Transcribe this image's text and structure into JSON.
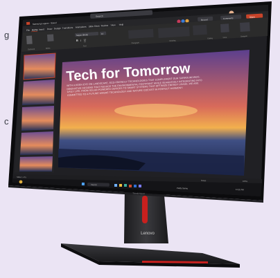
{
  "background_fragments": [
    "g",
    "c"
  ],
  "app": {
    "search_placeholder": "Search",
    "file_name": "Samsung Lagoon - Saved",
    "menu": [
      "File",
      "Home",
      "Insert",
      "Draw",
      "Design",
      "Transitions",
      "Animations",
      "Slide Show",
      "Review",
      "View",
      "Help"
    ],
    "active_menu": "Home",
    "record_label": "Record",
    "comments_label": "Comments",
    "share_label": "Share",
    "font_name": "Segoe (Body)",
    "font_size": "14",
    "ribbon_groups": [
      "Clipboard",
      "Slides",
      "Font",
      "Paragraph",
      "Drawing",
      "Editing",
      "Voice",
      "Designer"
    ]
  },
  "slide": {
    "title": "Tech for Tomorrow",
    "body": "WITH A KEEN EYE ON LANDSCAPE, ECO-FRIENDLY TECHNOLOGIES THAT COMPLEMENT OUR SURROUNDINGS. INNOVATIVE DESIGNS THAT REDUCE THE ENVIRONMENTAL FOOTPRINT WHILE SEAMLESSLY INTEGRATING INTO DAILY LIFE. FROM SOLAR-POWERED DEVICES TO SMART SYSTEMS THAT OPTIMIZE ENERGY USAGE, WE ARE COMMITTED TO A FUTURE WHERE TECHNOLOGY AND NATURE COEXIST IN PERFECT HARMONY.",
    "thumbnail_count": 5
  },
  "status_bar": {
    "slide_info": "Slide 1 of 5",
    "notes_label": "Notes",
    "zoom": "100%"
  },
  "taskbar": {
    "search_placeholder": "Search",
    "time": "11:11 AM",
    "weather": "Partly Sunny",
    "time_right": "11:11 PM"
  },
  "monitor": {
    "bezel_logo": "ThinkVision",
    "stand_logo": "Lenovo"
  },
  "colors": {
    "accent": "#c8442a",
    "stand_red": "#c8201e",
    "background": "#ebe4f4",
    "ribbon": "#2b2b2b"
  }
}
